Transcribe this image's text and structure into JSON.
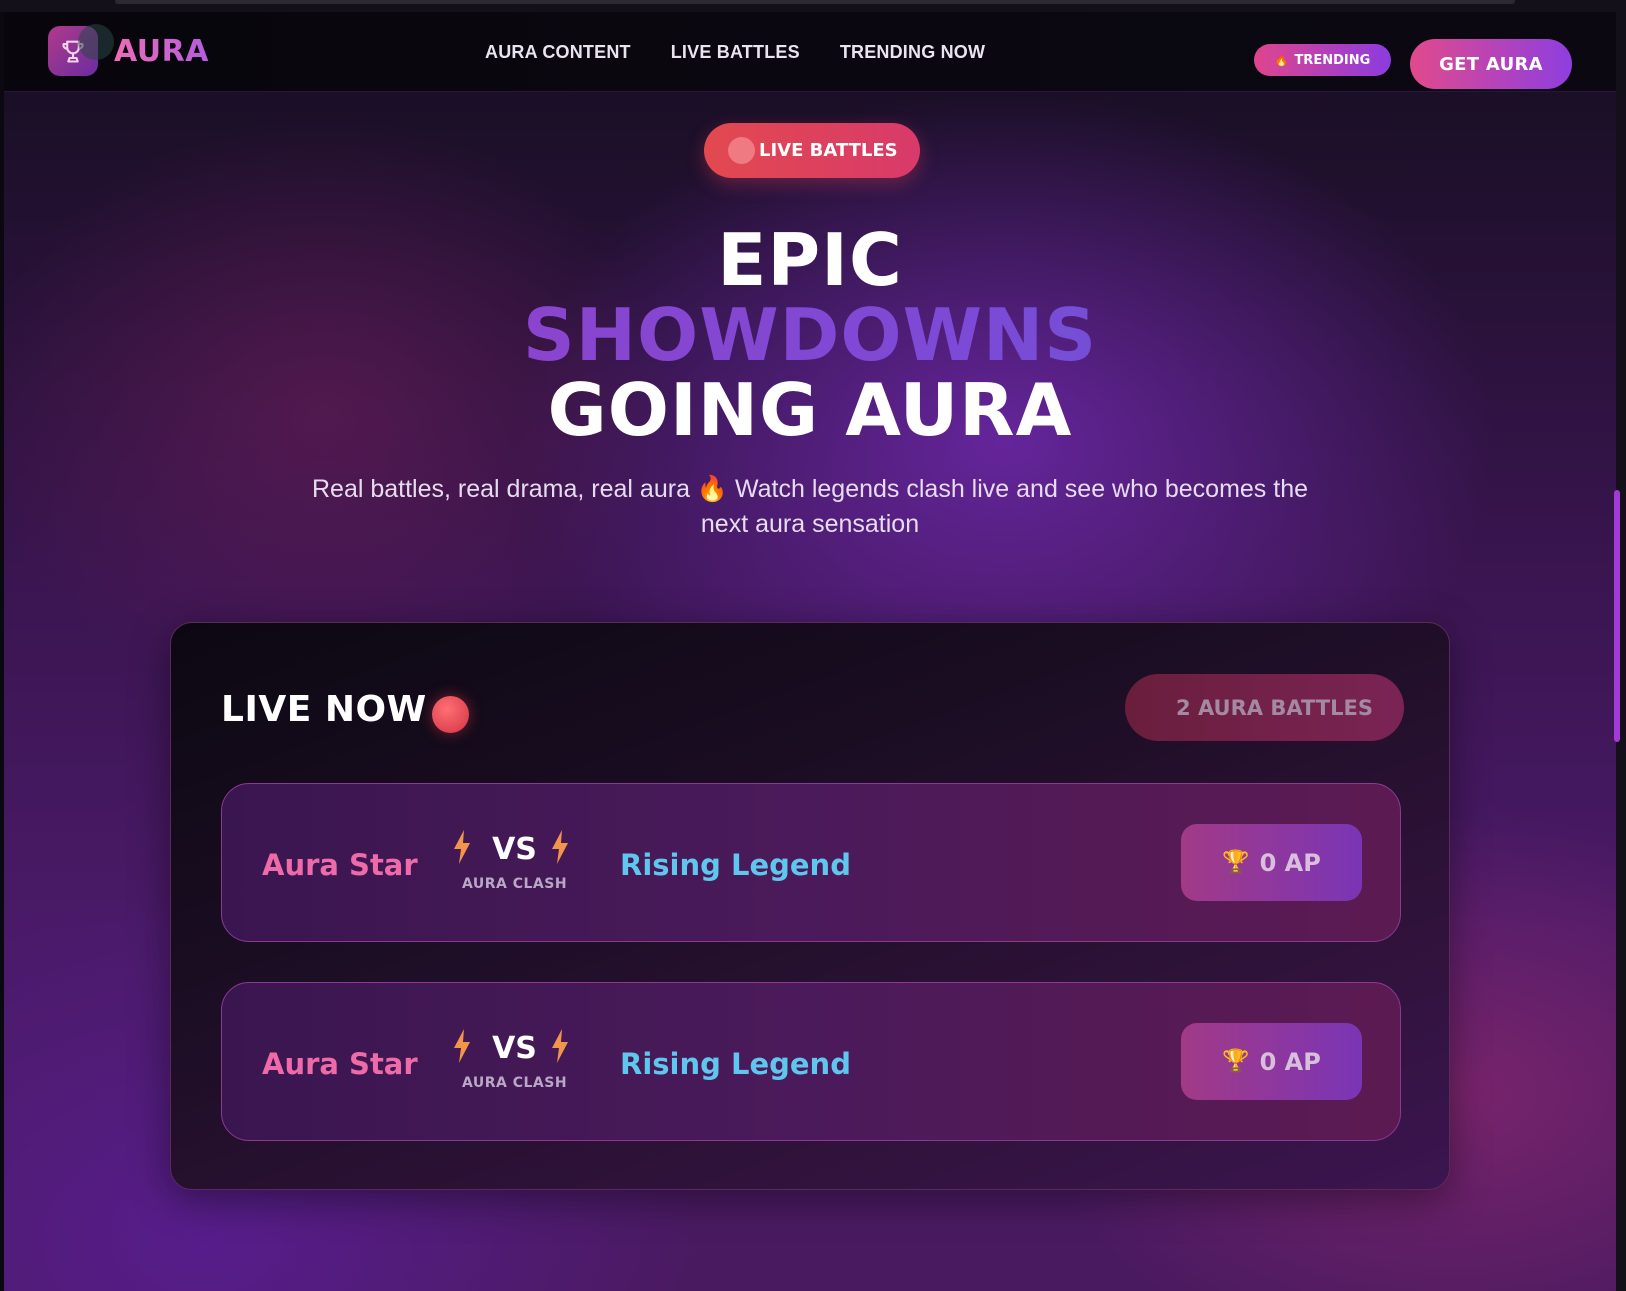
{
  "brand": {
    "name": "AURA",
    "logo_icon": "trophy-icon"
  },
  "nav": [
    {
      "label": "AURA CONTENT"
    },
    {
      "label": "LIVE BATTLES"
    },
    {
      "label": "TRENDING NOW"
    }
  ],
  "header": {
    "trending_badge": "TRENDING",
    "trending_icon": "🔥",
    "cta": "GET AURA"
  },
  "hero": {
    "pill": "LIVE BATTLES",
    "title_line1": "EPIC",
    "title_line2": "SHOWDOWNS",
    "title_line3": "GOING AURA",
    "subtitle": "Real battles, real drama, real aura 🔥 Watch legends clash live and see who becomes the next aura sensation"
  },
  "live": {
    "heading": "LIVE NOW",
    "count_label": "2 AURA BATTLES",
    "battles": [
      {
        "left": "Aura Star",
        "vs": "VS",
        "tag": "AURA CLASH",
        "right": "Rising Legend",
        "points": "0 AP",
        "points_icon": "🏆"
      },
      {
        "left": "Aura Star",
        "vs": "VS",
        "tag": "AURA CLASH",
        "right": "Rising Legend",
        "points": "0 AP",
        "points_icon": "🏆"
      }
    ]
  },
  "colors": {
    "accent_pink": "#e14a8c",
    "accent_purple": "#8e3ee0",
    "live_red": "#e2494f",
    "fighter_left": "#ee6aa8",
    "fighter_right": "#5fc7ee"
  }
}
